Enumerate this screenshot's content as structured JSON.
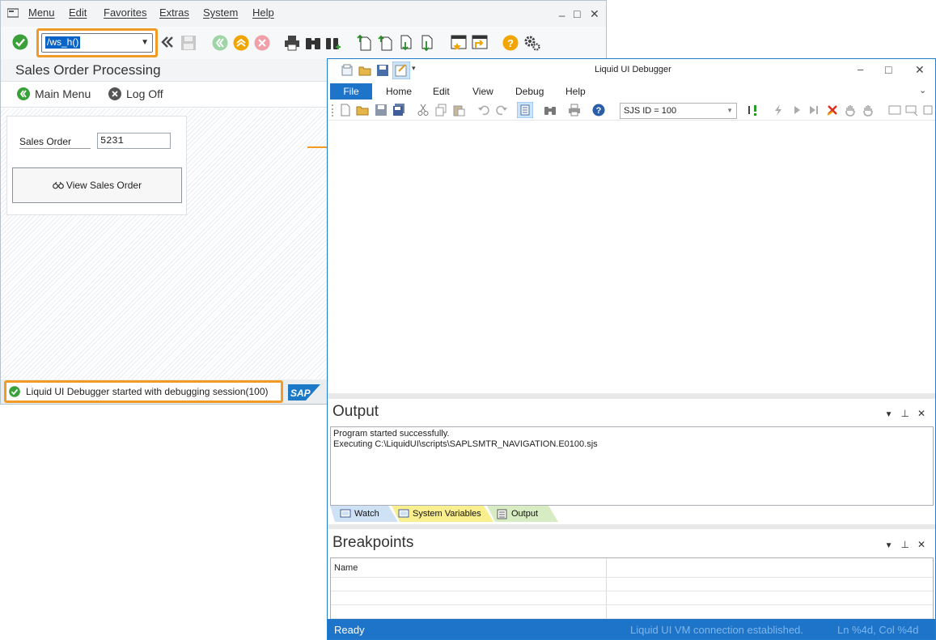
{
  "sap": {
    "menu": [
      "Menu",
      "Edit",
      "Favorites",
      "Extras",
      "System",
      "Help"
    ],
    "window_controls": [
      "_",
      "□",
      "✕"
    ],
    "command_field": {
      "value": "/ws_h()"
    },
    "screen_title": "Sales Order Processing",
    "app_toolbar": {
      "main_menu": "Main Menu",
      "log_off": "Log Off"
    },
    "form": {
      "label": "Sales Order",
      "value": "5231",
      "button": "View Sales Order"
    },
    "status_message": "Liquid UI Debugger started with debugging session(100)",
    "logo_text": "SAP",
    "colors": {
      "highlight": "#f19a26",
      "ok_green": "#3aa13a"
    }
  },
  "debugger": {
    "title": "Liquid UI Debugger",
    "window_controls": [
      "–",
      "□",
      "✕"
    ],
    "ribbon_tabs": [
      "File",
      "Home",
      "Edit",
      "View",
      "Debug",
      "Help"
    ],
    "sjs_id": "SJS ID = 100",
    "output": {
      "title": "Output",
      "lines": [
        "Program started successfully.",
        "Executing C:\\LiquidUI\\scripts\\SAPLSMTR_NAVIGATION.E0100.sjs"
      ],
      "tabs": [
        "Watch",
        "System Variables",
        "Output"
      ]
    },
    "breakpoints": {
      "title": "Breakpoints",
      "column": "Name"
    },
    "status": {
      "ready": "Ready",
      "connection": "Liquid UI VM connection established.",
      "position": "Ln %4d, Col %4d"
    },
    "colors": {
      "accent": "#1d74c9"
    }
  }
}
